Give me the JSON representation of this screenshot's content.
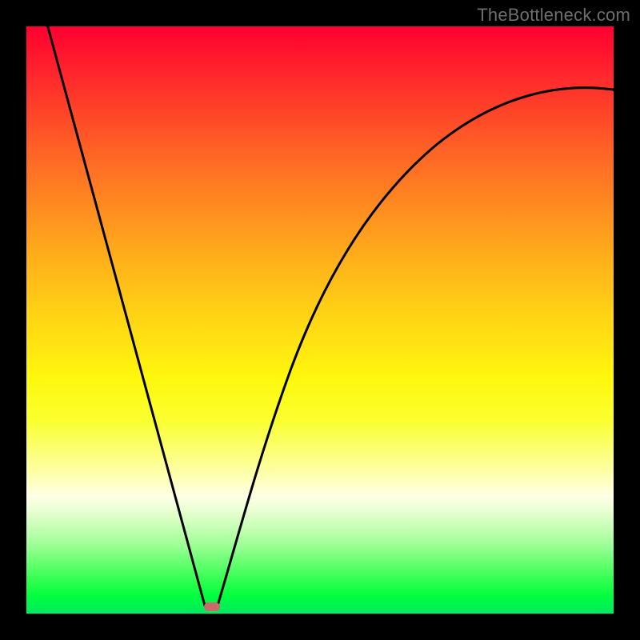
{
  "watermark": "TheBottleneck.com",
  "chart_data": {
    "type": "line",
    "title": "",
    "xlabel": "",
    "ylabel": "",
    "x_range_fraction": [
      0,
      1
    ],
    "y_range_percent": [
      0,
      100
    ],
    "optimum_x_fraction": 0.31,
    "series": [
      {
        "name": "bottleneck-curve",
        "x": [
          0.0,
          0.04,
          0.08,
          0.12,
          0.16,
          0.2,
          0.24,
          0.28,
          0.31,
          0.33,
          0.36,
          0.4,
          0.46,
          0.52,
          0.6,
          0.7,
          0.82,
          0.92,
          1.0
        ],
        "y": [
          100,
          86,
          73,
          60,
          47,
          34,
          21,
          9,
          0,
          4,
          12,
          25,
          40,
          52,
          64,
          74,
          82,
          86,
          88
        ],
        "note": "Percent bottleneck read visually from rainbow gradient. Zero (optimal) occurs near x≈0.31. Left branch rises steeply; right branch is sub-linear asymptotic toward ≈88% at the right edge."
      }
    ],
    "marker": {
      "x_fraction": 0.31,
      "y_percent": 0,
      "color": "#c96a6a",
      "shape": "rounded-rect"
    },
    "gradient_stops_percent": {
      "red": 0,
      "yellow": 50,
      "pale_yellow": 78,
      "green": 100
    }
  }
}
